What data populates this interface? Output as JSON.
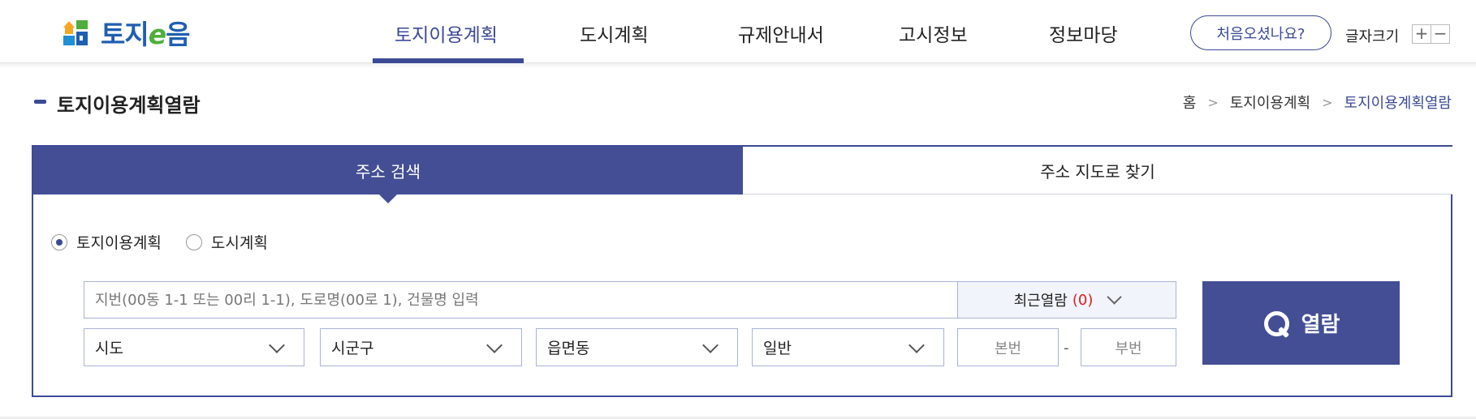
{
  "header": {
    "logo_text_1": "토지",
    "logo_text_e": "e",
    "logo_text_2": "음",
    "nav": [
      {
        "label": "토지이용계획",
        "active": true
      },
      {
        "label": "도시계획",
        "active": false
      },
      {
        "label": "규제안내서",
        "active": false
      },
      {
        "label": "고시정보",
        "active": false
      },
      {
        "label": "정보마당",
        "active": false
      }
    ],
    "first_visit_button": "처음오셨나요?",
    "font_size_label": "글자크기",
    "font_plus": "+",
    "font_minus": "−"
  },
  "page": {
    "title": "토지이용계획열람",
    "breadcrumb": [
      "홈",
      "토지이용계획",
      "토지이용계획열람"
    ],
    "breadcrumb_separator": ">"
  },
  "search": {
    "tabs": [
      {
        "label": "주소 검색",
        "active": true
      },
      {
        "label": "주소 지도로 찾기",
        "active": false
      }
    ],
    "radios": [
      {
        "label": "토지이용계획",
        "checked": true
      },
      {
        "label": "도시계획",
        "checked": false
      }
    ],
    "placeholder": "지번(00동 1-1 또는 00리 1-1), 도로명(00로 1), 건물명 입력",
    "recent_label": "최근열람",
    "recent_count": "(0)",
    "selects": {
      "sido": "시도",
      "sigungu": "시군구",
      "eupmyeondong": "읍면동",
      "type": "일반"
    },
    "main_number_placeholder": "본번",
    "sub_number_placeholder": "부번",
    "number_dash": "-",
    "view_button": "열람"
  },
  "colors": {
    "primary": "#434e94",
    "accent_text": "#3c4a96",
    "recent_count": "#e01b1b",
    "logo_blue": "#1f5fb0",
    "logo_green": "#4fae3b"
  }
}
